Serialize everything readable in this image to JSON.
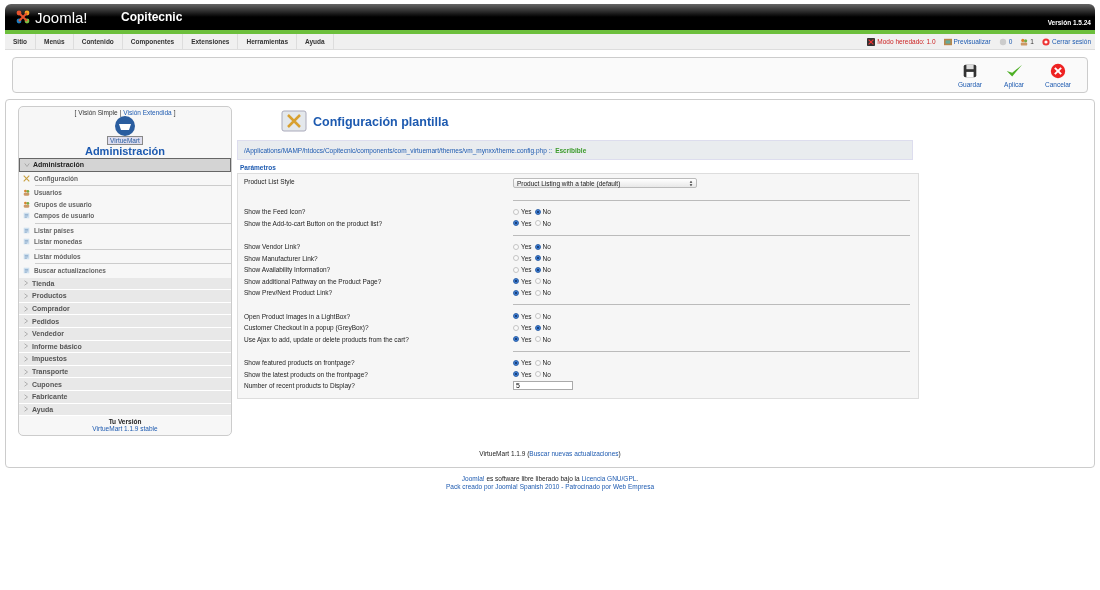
{
  "header": {
    "logo": "Joomla!",
    "site": "Copitecnic",
    "version": "Versión 1.5.24"
  },
  "menu": [
    "Sitio",
    "Menús",
    "Contenido",
    "Componentes",
    "Extensiones",
    "Herramientas",
    "Ayuda"
  ],
  "status": [
    {
      "kind": "legacy",
      "text": "Modo heredado: 1.0"
    },
    {
      "kind": "preview",
      "text": "Previsualizar"
    },
    {
      "kind": "messages",
      "text": "0"
    },
    {
      "kind": "users",
      "text": "1"
    },
    {
      "kind": "logout",
      "text": "Cerrar sesión"
    }
  ],
  "toolbar": [
    {
      "kind": "save",
      "label": "Guardar"
    },
    {
      "kind": "apply",
      "label": "Aplicar"
    },
    {
      "kind": "cancel",
      "label": "Cancelar"
    }
  ],
  "sidebar": {
    "bracket_open": "[",
    "separator": "|",
    "bracket_close": "]",
    "views": [
      {
        "label": "Visión Simple",
        "selected": true
      },
      {
        "label": "Visión Extendida",
        "selected": false
      }
    ],
    "logo": "VirtueMart",
    "title": "Administración",
    "sections": [
      {
        "label": "Administración",
        "expanded": true,
        "groups": [
          [
            {
              "kind": "tools",
              "label": "Configuración"
            }
          ],
          [
            {
              "kind": "users",
              "label": "Usuarios"
            },
            {
              "kind": "users",
              "label": "Grupos de usuario"
            },
            {
              "kind": "list",
              "label": "Campos de usuario"
            }
          ],
          [
            {
              "kind": "list",
              "label": "Listar países"
            },
            {
              "kind": "list",
              "label": "Listar monedas"
            }
          ],
          [
            {
              "kind": "list",
              "label": "Listar módulos"
            }
          ],
          [
            {
              "kind": "list",
              "label": "Buscar actualizaciones"
            }
          ]
        ]
      },
      {
        "label": "Tienda",
        "expanded": false
      },
      {
        "label": "Productos",
        "expanded": false
      },
      {
        "label": "Comprador",
        "expanded": false
      },
      {
        "label": "Pedidos",
        "expanded": false
      },
      {
        "label": "Vendedor",
        "expanded": false
      },
      {
        "label": "Informe básico",
        "expanded": false
      },
      {
        "label": "Impuestos",
        "expanded": false
      },
      {
        "label": "Transporte",
        "expanded": false
      },
      {
        "label": "Cupones",
        "expanded": false
      },
      {
        "label": "Fabricante",
        "expanded": false
      },
      {
        "label": "Ayuda",
        "expanded": false
      }
    ],
    "version_label": "Tu Versión",
    "version": "VirtueMart 1.1.9 stable"
  },
  "page": {
    "title": "Configuración plantilla",
    "path": "/Applications/MAMP/htdocs/Copitecnic/components/com_virtuemart/themes/vm_mynxx/theme.config.php ::",
    "writable": "Escribible",
    "legend": "Parámetros",
    "groups": [
      [
        {
          "kind": "select",
          "label": "Product List Style",
          "value": "Product Listing with a table (default)"
        }
      ],
      [
        {
          "kind": "radio",
          "label": "Show the Feed Icon?",
          "options": [
            {
              "label": "Yes",
              "selected": false
            },
            {
              "label": "No",
              "selected": true
            }
          ]
        },
        {
          "kind": "radio",
          "label": "Show the Add-to-cart Button on the product list?",
          "options": [
            {
              "label": "Yes",
              "selected": true
            },
            {
              "label": "No",
              "selected": false
            }
          ]
        }
      ],
      [
        {
          "kind": "radio",
          "label": "Show Vendor Link?",
          "options": [
            {
              "label": "Yes",
              "selected": false
            },
            {
              "label": "No",
              "selected": true
            }
          ]
        },
        {
          "kind": "radio",
          "label": "Show Manufacturer Link?",
          "options": [
            {
              "label": "Yes",
              "selected": false
            },
            {
              "label": "No",
              "selected": true
            }
          ]
        },
        {
          "kind": "radio",
          "label": "Show Availability Information?",
          "options": [
            {
              "label": "Yes",
              "selected": false
            },
            {
              "label": "No",
              "selected": true
            }
          ]
        },
        {
          "kind": "radio",
          "label": "Show additional Pathway on the Product Page?",
          "options": [
            {
              "label": "Yes",
              "selected": true
            },
            {
              "label": "No",
              "selected": false
            }
          ]
        },
        {
          "kind": "radio",
          "label": "Show Prev/Next Product Link?",
          "options": [
            {
              "label": "Yes",
              "selected": true
            },
            {
              "label": "No",
              "selected": false
            }
          ]
        }
      ],
      [
        {
          "kind": "radio",
          "label": "Open Product Images in a LightBox?",
          "options": [
            {
              "label": "Yes",
              "selected": true
            },
            {
              "label": "No",
              "selected": false
            }
          ]
        },
        {
          "kind": "radio",
          "label": "Customer Checkout in a popup (GreyBox)?",
          "options": [
            {
              "label": "Yes",
              "selected": false
            },
            {
              "label": "No",
              "selected": true
            }
          ]
        },
        {
          "kind": "radio",
          "label": "Use Ajax to add, update or delete products from the cart?",
          "options": [
            {
              "label": "Yes",
              "selected": true
            },
            {
              "label": "No",
              "selected": false
            }
          ]
        }
      ],
      [
        {
          "kind": "radio",
          "label": "Show featured products on frontpage?",
          "options": [
            {
              "label": "Yes",
              "selected": true
            },
            {
              "label": "No",
              "selected": false
            }
          ]
        },
        {
          "kind": "radio",
          "label": "Show the latest products on the frontpage?",
          "options": [
            {
              "label": "Yes",
              "selected": true
            },
            {
              "label": "No",
              "selected": false
            }
          ]
        },
        {
          "kind": "text",
          "label": "Number of recent products to Display?",
          "value": "5"
        }
      ]
    ],
    "note": {
      "before": "VirtueMart 1.1.9 (",
      "link": "Buscar nuevas actualizaciones",
      "after": ")"
    }
  },
  "footer": {
    "link1": "Joomla!",
    "middle": " es software libre liberado bajo la ",
    "link2": "Licencia GNU/GPL",
    "end": ".",
    "line2": "Pack creado por Joomla! Spanish 2010 - Patrocinado por Web Empresa"
  }
}
